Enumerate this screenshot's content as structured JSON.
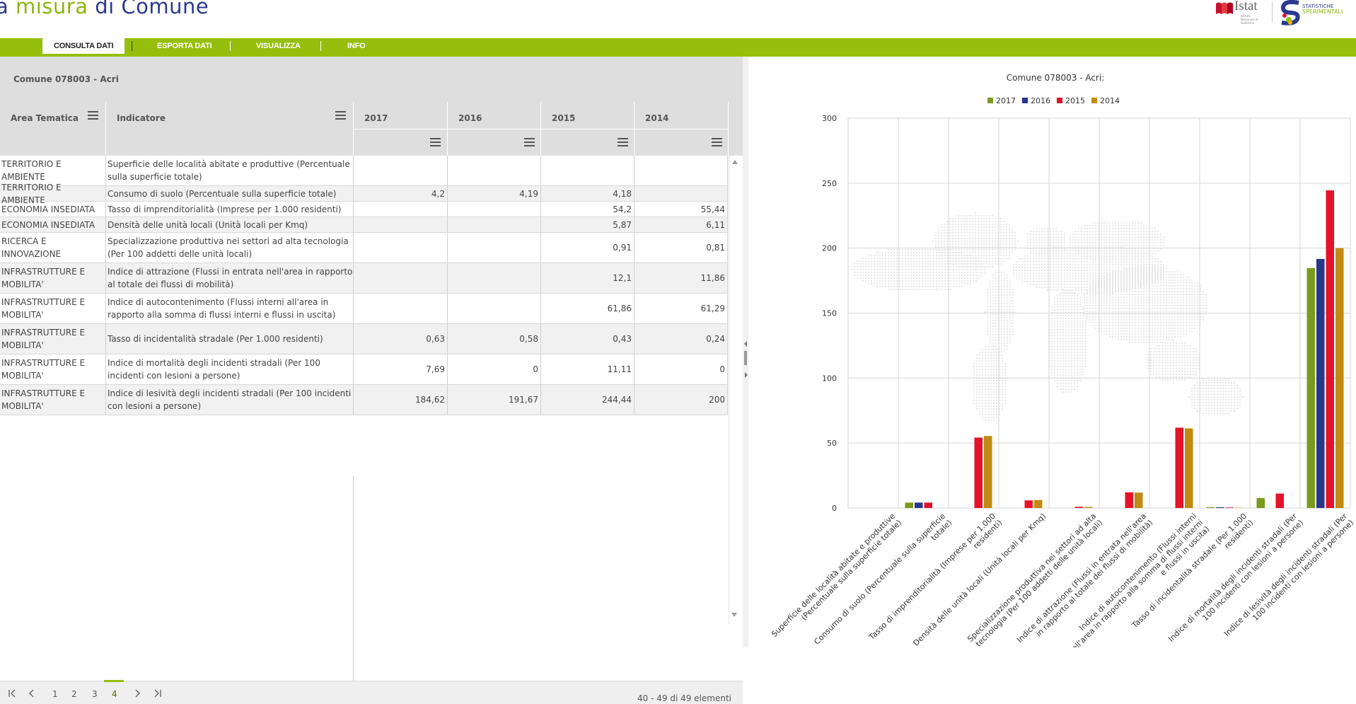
{
  "header": {
    "brand_prefix": "a ",
    "brand_green": "misura",
    "brand_suffix": " di Comune",
    "istat_word": "Istat",
    "istat_sub": "Istituto Nazionale di Statistica",
    "stat_line1": "STATISTICHE",
    "stat_line2": "SPERIMENTALI"
  },
  "nav": {
    "items": [
      {
        "label": "CONSULTA DATI",
        "active": true
      },
      {
        "label": "ESPORTA DATI",
        "active": false
      },
      {
        "label": "VISUALIZZA",
        "active": false
      },
      {
        "label": "INFO",
        "active": false
      }
    ]
  },
  "grid": {
    "title": "Comune 078003 - Acri",
    "columns": {
      "area": "Area Tematica",
      "indicator": "Indicatore",
      "years": [
        "2017",
        "2016",
        "2015",
        "2014"
      ]
    },
    "rows": [
      {
        "area": "TERRITORIO E AMBIENTE",
        "indicator": "Superficie delle località abitate e produttive (Percentuale sulla superficie totale)",
        "v2017": "",
        "v2016": "",
        "v2015": "",
        "v2014": ""
      },
      {
        "area": "TERRITORIO E AMBIENTE",
        "indicator": "Consumo di suolo (Percentuale sulla superficie totale)",
        "v2017": "4,2",
        "v2016": "4,19",
        "v2015": "4,18",
        "v2014": ""
      },
      {
        "area": "ECONOMIA INSEDIATA",
        "indicator": "Tasso di imprenditorialità (Imprese per 1.000 residenti)",
        "v2017": "",
        "v2016": "",
        "v2015": "54,2",
        "v2014": "55,44"
      },
      {
        "area": "ECONOMIA INSEDIATA",
        "indicator": "Densità delle unità locali (Unità locali per Kmq)",
        "v2017": "",
        "v2016": "",
        "v2015": "5,87",
        "v2014": "6,11"
      },
      {
        "area": "RICERCA E INNOVAZIONE",
        "indicator": "Specializzazione produttiva nei settori ad alta tecnologia (Per 100 addetti delle unità locali)",
        "v2017": "",
        "v2016": "",
        "v2015": "0,91",
        "v2014": "0,81"
      },
      {
        "area": "INFRASTRUTTURE E MOBILITA'",
        "indicator": "Indice di attrazione (Flussi in entrata nell'area in rapporto al totale dei flussi di mobilità)",
        "v2017": "",
        "v2016": "",
        "v2015": "12,1",
        "v2014": "11,86"
      },
      {
        "area": "INFRASTRUTTURE E MOBILITA'",
        "indicator": "Indice di autocontenimento (Flussi interni all'area in rapporto alla somma di flussi interni e flussi in uscita)",
        "v2017": "",
        "v2016": "",
        "v2015": "61,86",
        "v2014": "61,29"
      },
      {
        "area": "INFRASTRUTTURE E MOBILITA'",
        "indicator": "Tasso di incidentalità stradale (Per 1.000 residenti)",
        "v2017": "0,63",
        "v2016": "0,58",
        "v2015": "0,43",
        "v2014": "0,24"
      },
      {
        "area": "INFRASTRUTTURE E MOBILITA'",
        "indicator": "Indice di mortalità degli incidenti stradali (Per 100 incidenti con lesioni a persone)",
        "v2017": "7,69",
        "v2016": "0",
        "v2015": "11,11",
        "v2014": "0"
      },
      {
        "area": "INFRASTRUTTURE E MOBILITA'",
        "indicator": "Indice di lesività degli incidenti stradali (Per 100 incidenti con lesioni a persone)",
        "v2017": "184,62",
        "v2016": "191,67",
        "v2015": "244,44",
        "v2014": "200"
      }
    ]
  },
  "pager": {
    "pages": [
      "1",
      "2",
      "3",
      "4"
    ],
    "active_page": "4",
    "info": "40 - 49 di 49 elementi"
  },
  "icons": {
    "column_menu": "hamburger-menu-icon",
    "pager_first": "first-page-icon",
    "pager_prev": "prev-page-icon",
    "pager_next": "next-page-icon",
    "pager_last": "last-page-icon"
  },
  "colors": {
    "green": "#96bf0d",
    "navy": "#2b3a8f",
    "s2017": "#7a9a1e",
    "s2016": "#27388a",
    "s2015": "#e4122a",
    "s2014": "#c18a12"
  },
  "chart_data": {
    "type": "bar",
    "title": "Comune 078003 - Acri:",
    "legend_position": "top-center",
    "grid": true,
    "ylim": [
      0,
      300
    ],
    "yticks": [
      0,
      50,
      100,
      150,
      200,
      250,
      300
    ],
    "categories": [
      "Superficie delle località abitate e produttive (Percentuale sulla superficie totale)",
      "Consumo di suolo (Percentuale sulla superficie totale)",
      "Tasso di imprenditorialità (Imprese per 1.000 residenti)",
      "Densità delle unità locali (Unità locali per Kmq)",
      "Specializzazione produttiva nei settori ad alta tecnologia (Per 100 addetti delle unità locali)",
      "Indice di attrazione (Flussi in entrata nell'area in rapporto al totale dei flussi di mobilità)",
      "Indice di autocontenimento (Flussi interni all'area in rapporto alla somma di flussi interni e flussi in uscita)",
      "Tasso di incidentalità stradale (Per 1.000 residenti)",
      "Indice di mortalità degli incidenti stradali (Per 100 incidenti con lesioni a persone)",
      "Indice di lesività degli incidenti stradali (Per 100 incidenti con lesioni a persone)"
    ],
    "category_lines": [
      [
        "Superficie delle località abitate e produttive",
        "(Percentuale sulla superficie totale)"
      ],
      [
        "Consumo di suolo (Percentuale sulla superficie",
        "totale)"
      ],
      [
        "Tasso di imprenditorialità (Imprese per 1.000",
        "residenti)"
      ],
      [
        "Densità delle unità locali (Unità locali per Kmq)"
      ],
      [
        "Specializzazione produttiva nei settori ad alta",
        "tecnologia (Per 100 addetti delle unità locali)"
      ],
      [
        "Indice di attrazione (Flussi in entrata nell'area",
        "in rapporto al totale dei flussi di mobilità)"
      ],
      [
        "Indice di autocontenimento (Flussi interni",
        "all'area in rapporto alla somma di flussi interni",
        "e flussi in uscita)"
      ],
      [
        "Tasso di incidentalità stradale (Per 1.000",
        "residenti)"
      ],
      [
        "Indice di mortalità degli incidenti stradali (Per",
        "100 incidenti con lesioni a persone)"
      ],
      [
        "Indice di lesività degli incidenti stradali (Per",
        "100 incidenti con lesioni a persone)"
      ]
    ],
    "series": [
      {
        "name": "2017",
        "color": "#7a9a1e",
        "values": [
          null,
          4.2,
          null,
          null,
          null,
          null,
          null,
          0.63,
          7.69,
          184.62
        ]
      },
      {
        "name": "2016",
        "color": "#27388a",
        "values": [
          null,
          4.19,
          null,
          null,
          null,
          null,
          null,
          0.58,
          0,
          191.67
        ]
      },
      {
        "name": "2015",
        "color": "#e4122a",
        "values": [
          null,
          4.18,
          54.2,
          5.87,
          0.91,
          12.1,
          61.86,
          0.43,
          11.11,
          244.44
        ]
      },
      {
        "name": "2014",
        "color": "#c18a12",
        "values": [
          null,
          null,
          55.44,
          6.11,
          0.81,
          11.86,
          61.29,
          0.24,
          0,
          200
        ]
      }
    ]
  }
}
